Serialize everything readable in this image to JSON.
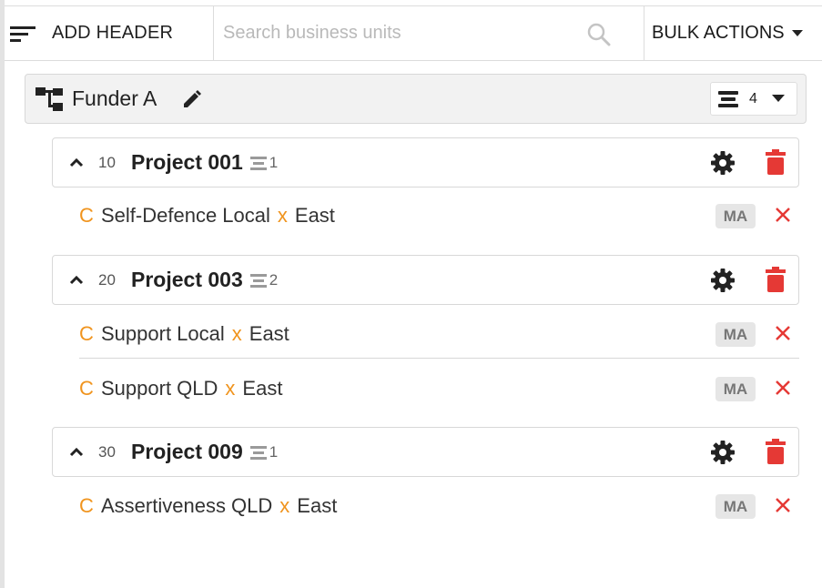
{
  "toolbar": {
    "add_header_label": "ADD HEADER",
    "search_placeholder": "Search business units",
    "bulk_actions_label": "BULK ACTIONS"
  },
  "funder": {
    "name": "Funder A",
    "count": "4"
  },
  "projects": [
    {
      "order": "10",
      "name": "Project 001",
      "count": "1",
      "items": [
        {
          "code": "C",
          "name": "Self-Defence Local",
          "separator": "x",
          "region": "East",
          "badge": "MA"
        }
      ]
    },
    {
      "order": "20",
      "name": "Project 003",
      "count": "2",
      "items": [
        {
          "code": "C",
          "name": "Support Local",
          "separator": "x",
          "region": "East",
          "badge": "MA"
        },
        {
          "code": "C",
          "name": "Support QLD",
          "separator": "x",
          "region": "East",
          "badge": "MA"
        }
      ]
    },
    {
      "order": "30",
      "name": "Project 009",
      "count": "1",
      "items": [
        {
          "code": "C",
          "name": "Assertiveness QLD",
          "separator": "x",
          "region": "East",
          "badge": "MA"
        }
      ]
    }
  ],
  "colors": {
    "accent_orange": "#f0941e",
    "delete_red": "#e53935",
    "badge_bg": "#e6e6e6"
  },
  "icons": {
    "add_header": "filter-list-icon",
    "search": "search-icon",
    "bulk_caret": "caret-down-icon",
    "funder": "org-tree-icon",
    "edit": "pencil-icon",
    "count": "list-icon",
    "collapse": "chevron-up-icon",
    "project_count": "stack-icon",
    "settings": "gear-icon",
    "delete": "trash-icon",
    "remove": "close-icon"
  }
}
